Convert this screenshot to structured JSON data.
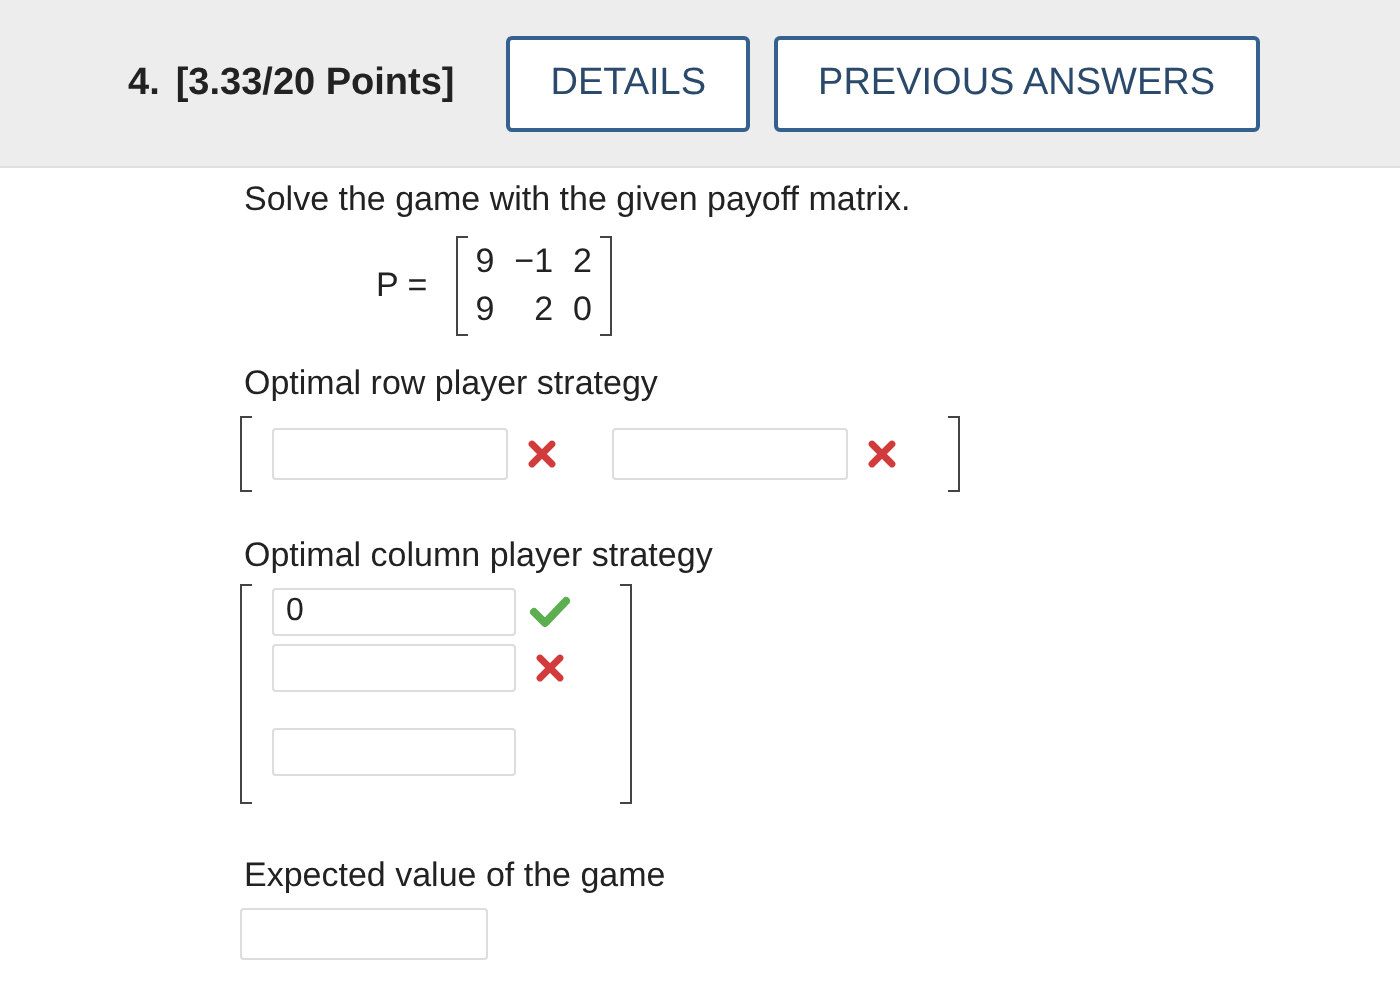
{
  "header": {
    "number": "4.",
    "points": "[3.33/20 Points]"
  },
  "buttons": [
    {
      "label": "DETAILS"
    },
    {
      "label": "PREVIOUS ANSWERS"
    }
  ],
  "question": "Solve the game with the given payoff matrix.",
  "matrix": {
    "name": "P =",
    "rows": [
      [
        "9",
        "−1",
        "2"
      ],
      [
        "9",
        "2",
        "0"
      ]
    ]
  },
  "row_strategy": {
    "label": "Optimal row player strategy",
    "fields": [
      {
        "kind": "graded",
        "correct": false
      },
      {
        "kind": "graded",
        "correct": false
      }
    ]
  },
  "column_strategy": {
    "label": "Optimal column player strategy",
    "fields": [
      {
        "kind": "graded",
        "value": "0",
        "correct": true
      },
      {
        "kind": "graded",
        "correct": false
      },
      {
        "kind": "plain"
      }
    ]
  },
  "expected_value": {
    "label": "Expected value of the game"
  }
}
